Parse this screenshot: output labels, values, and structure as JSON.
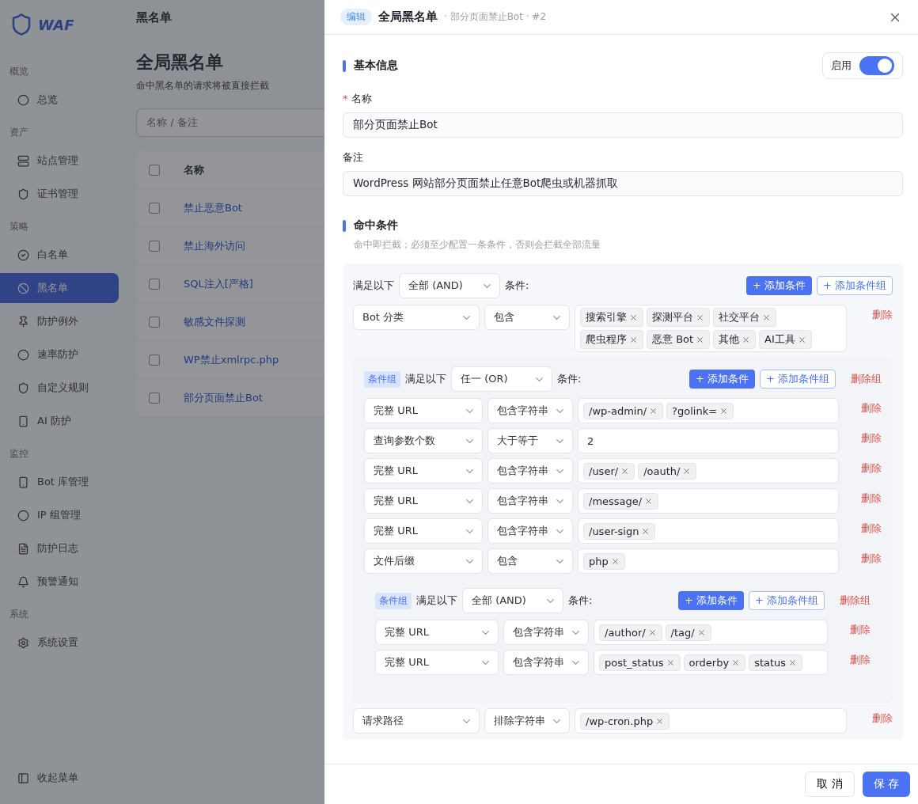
{
  "app": {
    "logo": "WAF",
    "topbar_title": "黑名单",
    "collapse": "收起菜单"
  },
  "sidebar": [
    {
      "section": "概览",
      "items": [
        {
          "label": "总览",
          "selected": false
        }
      ]
    },
    {
      "section": "资产",
      "items": [
        {
          "label": "站点管理",
          "selected": false
        },
        {
          "label": "证书管理",
          "selected": false
        }
      ]
    },
    {
      "section": "策略",
      "items": [
        {
          "label": "白名单",
          "selected": false
        },
        {
          "label": "黑名单",
          "selected": true
        },
        {
          "label": "防护例外",
          "selected": false
        },
        {
          "label": "速率防护",
          "selected": false
        },
        {
          "label": "自定义规则",
          "selected": false
        },
        {
          "label": "AI 防护",
          "selected": false
        }
      ]
    },
    {
      "section": "监控",
      "items": [
        {
          "label": "Bot 库管理",
          "selected": false
        },
        {
          "label": "IP 组管理",
          "selected": false
        },
        {
          "label": "防护日志",
          "selected": false
        },
        {
          "label": "预警通知",
          "selected": false
        }
      ]
    },
    {
      "section": "系统",
      "items": [
        {
          "label": "系统设置",
          "selected": false
        }
      ]
    }
  ],
  "page": {
    "title": "全局黑名单",
    "subtitle": "命中黑名单的请求将被直接拦截",
    "search_placeholder": "名称 / 备注",
    "column": "名称",
    "all_checked": false,
    "rows": [
      {
        "label": "禁止恶意Bot",
        "checked": false
      },
      {
        "label": "禁止海外访问",
        "checked": false
      },
      {
        "label": "SQL注入[严格]",
        "checked": false
      },
      {
        "label": "敏感文件探测",
        "checked": false
      },
      {
        "label": "WP禁止xmlrpc.php",
        "checked": false
      },
      {
        "label": "部分页面禁止Bot",
        "checked": false
      }
    ]
  },
  "drawer": {
    "badge": "编辑",
    "title": "全局黑名单",
    "subtitle": "· 部分页面禁止Bot · #2",
    "basic": {
      "heading": "基本信息",
      "enable_label": "启用",
      "enabled": true,
      "required_mark": "*",
      "name_label": "名称",
      "name": "部分页面禁止Bot",
      "note_label": "备注",
      "note": "WordPress 网站部分页面禁止任意Bot爬虫或机器抓取"
    },
    "conditions": {
      "heading": "命中条件",
      "hint": "命中即拦截；必须至少配置一条条件，否则会拦截全部流量",
      "root": {
        "kind": "group",
        "match_label": "满足以下",
        "match": "全部 (AND)",
        "suffix": "条件:",
        "add_condition": "+ 添加条件",
        "add_group": "+ 添加条件组",
        "items": [
          {
            "kind": "condition",
            "field": "Bot 分类",
            "operator": "包含",
            "tags": [
              "搜索引擎",
              "探测平台",
              "社交平台",
              "爬虫程序",
              "恶意 Bot",
              "其他",
              "AI工具"
            ],
            "delete": "删除"
          },
          {
            "kind": "group",
            "badge": "条件组",
            "match_label": "满足以下",
            "match": "任一 (OR)",
            "suffix": "条件:",
            "add_condition": "+ 添加条件",
            "add_group": "+ 添加条件组",
            "delete_group": "删除组",
            "items": [
              {
                "kind": "condition",
                "field": "完整 URL",
                "operator": "包含字符串",
                "tags": [
                  "/wp-admin/",
                  "?golink="
                ],
                "delete": "删除"
              },
              {
                "kind": "condition",
                "field": "查询参数个数",
                "operator": "大于等于",
                "value": "2",
                "delete": "删除"
              },
              {
                "kind": "condition",
                "field": "完整 URL",
                "operator": "包含字符串",
                "tags": [
                  "/user/",
                  "/oauth/"
                ],
                "delete": "删除"
              },
              {
                "kind": "condition",
                "field": "完整 URL",
                "operator": "包含字符串",
                "tags": [
                  "/message/"
                ],
                "delete": "删除"
              },
              {
                "kind": "condition",
                "field": "完整 URL",
                "operator": "包含字符串",
                "tags": [
                  "/user-sign"
                ],
                "delete": "删除"
              },
              {
                "kind": "condition",
                "field": "文件后缀",
                "operator": "包含",
                "tags": [
                  "php"
                ],
                "delete": "删除"
              },
              {
                "kind": "group",
                "badge": "条件组",
                "match_label": "满足以下",
                "match": "全部 (AND)",
                "suffix": "条件:",
                "add_condition": "+ 添加条件",
                "add_group": "+ 添加条件组",
                "delete_group": "删除组",
                "items": [
                  {
                    "kind": "condition",
                    "field": "完整 URL",
                    "operator": "包含字符串",
                    "tags": [
                      "/author/",
                      "/tag/"
                    ],
                    "delete": "删除"
                  },
                  {
                    "kind": "condition",
                    "field": "完整 URL",
                    "operator": "包含字符串",
                    "tags": [
                      "post_status",
                      "orderby",
                      "status"
                    ],
                    "delete": "删除"
                  }
                ]
              }
            ]
          },
          {
            "kind": "condition",
            "field": "请求路径",
            "operator": "排除字符串",
            "tags": [
              "/wp-cron.php"
            ],
            "delete": "删除"
          }
        ]
      }
    },
    "cancel": "取 消",
    "save": "保 存"
  }
}
